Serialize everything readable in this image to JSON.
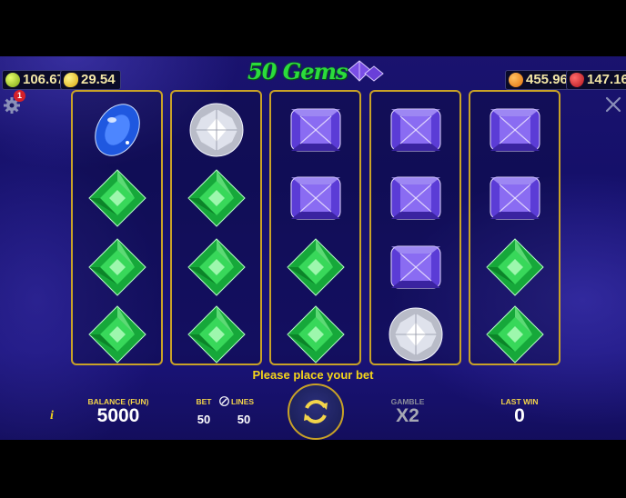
{
  "title": "50 Gems",
  "top_bar": {
    "pills": [
      {
        "name": "lime-jackpot",
        "value": "106.67",
        "color": "#b6d62a"
      },
      {
        "name": "lemon-jackpot",
        "value": "29.54",
        "color": "#f1d21e"
      },
      {
        "name": "orange-jackpot",
        "value": "455.96",
        "color": "#f08a12"
      },
      {
        "name": "strawberry-jackpot",
        "value": "147.16",
        "color": "#d2232a"
      }
    ],
    "notification_count": "1"
  },
  "reels": [
    [
      "blue-oval",
      "green-square",
      "green-square",
      "green-square"
    ],
    [
      "white-round",
      "green-square",
      "green-square",
      "green-square"
    ],
    [
      "purple-cushion",
      "purple-cushion",
      "green-square",
      "green-square"
    ],
    [
      "purple-cushion",
      "purple-cushion",
      "purple-cushion",
      "white-round"
    ],
    [
      "purple-cushion",
      "purple-cushion",
      "green-square",
      "green-square"
    ]
  ],
  "status_message": "Please place your bet",
  "bottom_bar": {
    "info_label": "i",
    "balance_label": "BALANCE (FUN)",
    "balance_value": "5000",
    "bet_label": "BET",
    "bet_value": "50",
    "lines_label": "LINES",
    "lines_value": "50",
    "gamble_label": "GAMBLE",
    "gamble_value": "X2",
    "last_win_label": "LAST WIN",
    "last_win_value": "0"
  },
  "colors": {
    "reel_border": "#c9a227",
    "label_yellow": "#f3d44a",
    "background": "#1c1470"
  }
}
